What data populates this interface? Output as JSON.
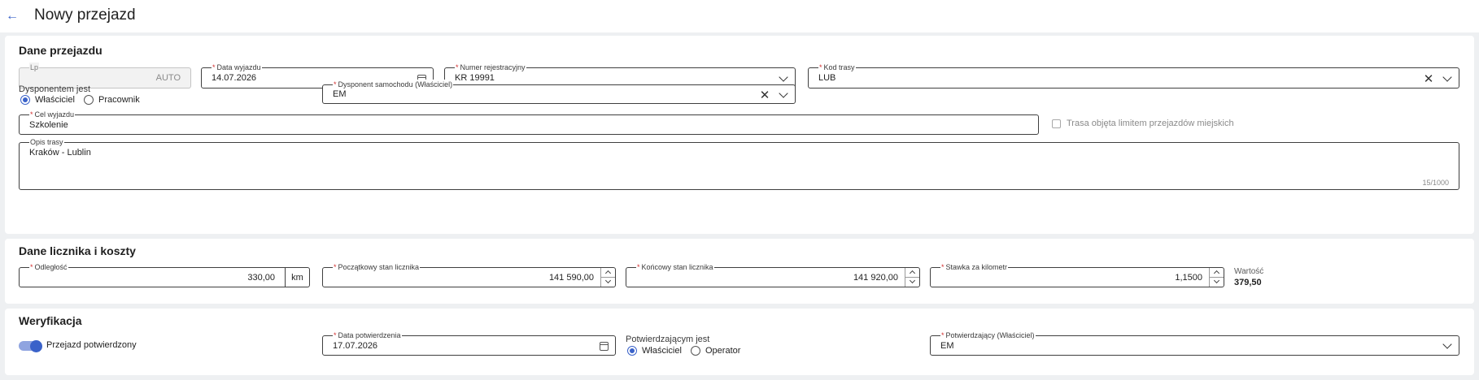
{
  "header": {
    "title": "Nowy przejazd"
  },
  "trip": {
    "title": "Dane przejazdu",
    "lp": {
      "label": "Lp",
      "value": "AUTO"
    },
    "departure_date": {
      "label": "Data wyjazdu",
      "value": "14.07.2026"
    },
    "registration": {
      "label": "Numer rejestracyjny",
      "value": "KR 19991"
    },
    "route_code": {
      "label": "Kod trasy",
      "value": "LUB"
    },
    "dispatcher_type": {
      "label": "Dysponentem jest",
      "options": [
        "Właściciel",
        "Pracownik"
      ],
      "selected": "Właściciel"
    },
    "car_dispatcher": {
      "label": "Dysponent samochodu (Właściciel)",
      "value": "EM"
    },
    "purpose": {
      "label": "Cel wyjazdu",
      "value": "Szkolenie"
    },
    "city_limit": {
      "label": "Trasa objęta limitem przejazdów miejskich",
      "checked": false
    },
    "route_description": {
      "label": "Opis trasy",
      "value": "Kraków - Lublin",
      "counter": "15/1000"
    }
  },
  "meter": {
    "title": "Dane licznika i koszty",
    "distance": {
      "label": "Odległość",
      "value": "330,00",
      "unit": "km"
    },
    "start_reading": {
      "label": "Początkowy stan licznika",
      "value": "141 590,00"
    },
    "end_reading": {
      "label": "Końcowy stan licznika",
      "value": "141 920,00"
    },
    "rate": {
      "label": "Stawka za kilometr",
      "value": "1,1500"
    },
    "total": {
      "label": "Wartość",
      "value": "379,50"
    }
  },
  "verification": {
    "title": "Weryfikacja",
    "confirmed": {
      "label": "Przejazd potwierdzony",
      "on": true
    },
    "confirmation_date": {
      "label": "Data potwierdzenia",
      "value": "17.07.2026"
    },
    "confirmer_type": {
      "label": "Potwierdzającym jest",
      "options": [
        "Właściciel",
        "Operator"
      ],
      "selected": "Właściciel"
    },
    "confirmer": {
      "label": "Potwierdzający (Właściciel)",
      "value": "EM"
    }
  },
  "colors": {
    "accent": "#3a62c9",
    "required": "#d32f2f",
    "background": "#eef0f2"
  }
}
